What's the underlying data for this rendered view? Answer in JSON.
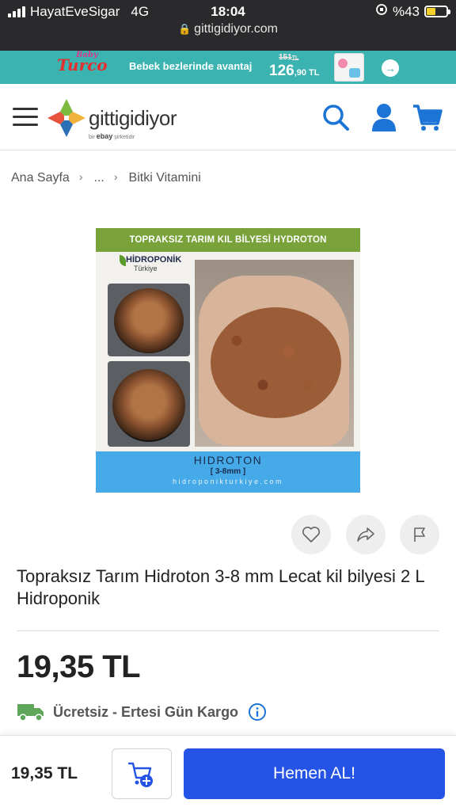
{
  "status_bar": {
    "carrier": "HayatEveSigar",
    "network": "4G",
    "time": "18:04",
    "battery": "%43",
    "url": "gittigidiyor.com"
  },
  "promo": {
    "brand_small": "Baby",
    "brand": "Turco",
    "text": "Bebek bezlerinde avantaj",
    "old_price": "151",
    "old_suffix": "TL",
    "new_price_int": "126",
    "new_price_dec": ",90 TL"
  },
  "header": {
    "logo_text": "gittigidiyor",
    "logo_sub_prefix": "bir",
    "logo_sub_brand": "ebay",
    "logo_sub_suffix": "şirketidir"
  },
  "breadcrumb": [
    "Ana Sayfa",
    "...",
    "Bitki Vitamini"
  ],
  "product_image": {
    "top_banner": "TOPRAKSIZ TARIM KIL BİLYESİ HYDROTON",
    "brand_line1": "HİDROPONİK",
    "brand_line2": "Türkiye",
    "label": "HIDROTON",
    "size": "[ 3-8mm ]",
    "site": "hidroponikturkiye.com"
  },
  "product": {
    "title": "Topraksız Tarım Hidroton 3-8 mm Lecat kil bilyesi 2 L Hidroponik",
    "price": "19,35 TL",
    "shipping": "Ücretsiz - Ertesi Gün Kargo"
  },
  "bottom_bar": {
    "price": "19,35 TL",
    "buy_label": "Hemen AL!"
  },
  "colors": {
    "accent_blue": "#2553e6",
    "icon_blue": "#1b74d6",
    "shipping_green": "#5fa55a",
    "promo_teal": "#3bb3b0"
  }
}
